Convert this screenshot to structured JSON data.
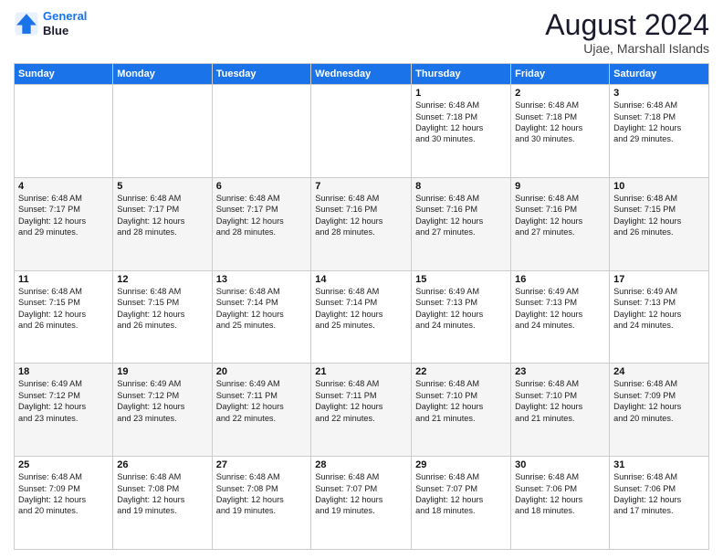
{
  "header": {
    "logo_line1": "General",
    "logo_line2": "Blue",
    "main_title": "August 2024",
    "sub_title": "Ujae, Marshall Islands"
  },
  "days_of_week": [
    "Sunday",
    "Monday",
    "Tuesday",
    "Wednesday",
    "Thursday",
    "Friday",
    "Saturday"
  ],
  "weeks": [
    [
      {
        "day": "",
        "info": ""
      },
      {
        "day": "",
        "info": ""
      },
      {
        "day": "",
        "info": ""
      },
      {
        "day": "",
        "info": ""
      },
      {
        "day": "1",
        "info": "Sunrise: 6:48 AM\nSunset: 7:18 PM\nDaylight: 12 hours\nand 30 minutes."
      },
      {
        "day": "2",
        "info": "Sunrise: 6:48 AM\nSunset: 7:18 PM\nDaylight: 12 hours\nand 30 minutes."
      },
      {
        "day": "3",
        "info": "Sunrise: 6:48 AM\nSunset: 7:18 PM\nDaylight: 12 hours\nand 29 minutes."
      }
    ],
    [
      {
        "day": "4",
        "info": "Sunrise: 6:48 AM\nSunset: 7:17 PM\nDaylight: 12 hours\nand 29 minutes."
      },
      {
        "day": "5",
        "info": "Sunrise: 6:48 AM\nSunset: 7:17 PM\nDaylight: 12 hours\nand 28 minutes."
      },
      {
        "day": "6",
        "info": "Sunrise: 6:48 AM\nSunset: 7:17 PM\nDaylight: 12 hours\nand 28 minutes."
      },
      {
        "day": "7",
        "info": "Sunrise: 6:48 AM\nSunset: 7:16 PM\nDaylight: 12 hours\nand 28 minutes."
      },
      {
        "day": "8",
        "info": "Sunrise: 6:48 AM\nSunset: 7:16 PM\nDaylight: 12 hours\nand 27 minutes."
      },
      {
        "day": "9",
        "info": "Sunrise: 6:48 AM\nSunset: 7:16 PM\nDaylight: 12 hours\nand 27 minutes."
      },
      {
        "day": "10",
        "info": "Sunrise: 6:48 AM\nSunset: 7:15 PM\nDaylight: 12 hours\nand 26 minutes."
      }
    ],
    [
      {
        "day": "11",
        "info": "Sunrise: 6:48 AM\nSunset: 7:15 PM\nDaylight: 12 hours\nand 26 minutes."
      },
      {
        "day": "12",
        "info": "Sunrise: 6:48 AM\nSunset: 7:15 PM\nDaylight: 12 hours\nand 26 minutes."
      },
      {
        "day": "13",
        "info": "Sunrise: 6:48 AM\nSunset: 7:14 PM\nDaylight: 12 hours\nand 25 minutes."
      },
      {
        "day": "14",
        "info": "Sunrise: 6:48 AM\nSunset: 7:14 PM\nDaylight: 12 hours\nand 25 minutes."
      },
      {
        "day": "15",
        "info": "Sunrise: 6:49 AM\nSunset: 7:13 PM\nDaylight: 12 hours\nand 24 minutes."
      },
      {
        "day": "16",
        "info": "Sunrise: 6:49 AM\nSunset: 7:13 PM\nDaylight: 12 hours\nand 24 minutes."
      },
      {
        "day": "17",
        "info": "Sunrise: 6:49 AM\nSunset: 7:13 PM\nDaylight: 12 hours\nand 24 minutes."
      }
    ],
    [
      {
        "day": "18",
        "info": "Sunrise: 6:49 AM\nSunset: 7:12 PM\nDaylight: 12 hours\nand 23 minutes."
      },
      {
        "day": "19",
        "info": "Sunrise: 6:49 AM\nSunset: 7:12 PM\nDaylight: 12 hours\nand 23 minutes."
      },
      {
        "day": "20",
        "info": "Sunrise: 6:49 AM\nSunset: 7:11 PM\nDaylight: 12 hours\nand 22 minutes."
      },
      {
        "day": "21",
        "info": "Sunrise: 6:48 AM\nSunset: 7:11 PM\nDaylight: 12 hours\nand 22 minutes."
      },
      {
        "day": "22",
        "info": "Sunrise: 6:48 AM\nSunset: 7:10 PM\nDaylight: 12 hours\nand 21 minutes."
      },
      {
        "day": "23",
        "info": "Sunrise: 6:48 AM\nSunset: 7:10 PM\nDaylight: 12 hours\nand 21 minutes."
      },
      {
        "day": "24",
        "info": "Sunrise: 6:48 AM\nSunset: 7:09 PM\nDaylight: 12 hours\nand 20 minutes."
      }
    ],
    [
      {
        "day": "25",
        "info": "Sunrise: 6:48 AM\nSunset: 7:09 PM\nDaylight: 12 hours\nand 20 minutes."
      },
      {
        "day": "26",
        "info": "Sunrise: 6:48 AM\nSunset: 7:08 PM\nDaylight: 12 hours\nand 19 minutes."
      },
      {
        "day": "27",
        "info": "Sunrise: 6:48 AM\nSunset: 7:08 PM\nDaylight: 12 hours\nand 19 minutes."
      },
      {
        "day": "28",
        "info": "Sunrise: 6:48 AM\nSunset: 7:07 PM\nDaylight: 12 hours\nand 19 minutes."
      },
      {
        "day": "29",
        "info": "Sunrise: 6:48 AM\nSunset: 7:07 PM\nDaylight: 12 hours\nand 18 minutes."
      },
      {
        "day": "30",
        "info": "Sunrise: 6:48 AM\nSunset: 7:06 PM\nDaylight: 12 hours\nand 18 minutes."
      },
      {
        "day": "31",
        "info": "Sunrise: 6:48 AM\nSunset: 7:06 PM\nDaylight: 12 hours\nand 17 minutes."
      }
    ]
  ]
}
